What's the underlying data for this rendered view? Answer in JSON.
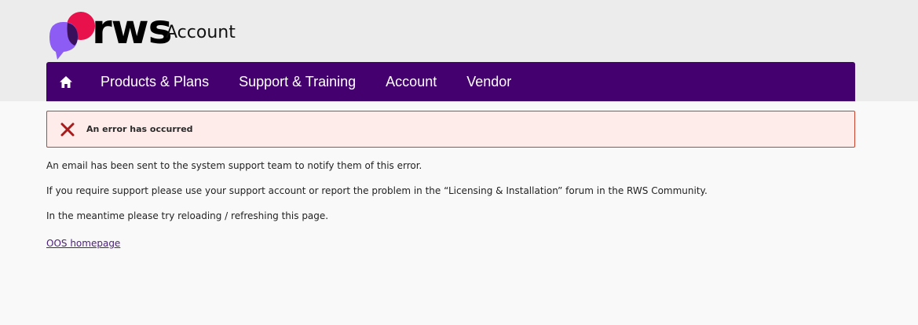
{
  "brand": {
    "wordmark": "rws",
    "suffix": "Account",
    "colors": {
      "logo_pink": "#e8114c",
      "logo_purple": "#8c5cf5",
      "logo_dark": "#3a0f5c",
      "nav_bg": "#44006e"
    }
  },
  "nav": {
    "home_icon": "home-icon",
    "items": [
      {
        "label": "Products & Plans"
      },
      {
        "label": "Support & Training"
      },
      {
        "label": "Account"
      },
      {
        "label": "Vendor"
      }
    ]
  },
  "alert": {
    "icon": "close-x-icon",
    "message": "An error has occurred",
    "colors": {
      "bg": "#fdecea",
      "border": "#c9412b",
      "icon": "#a61b1b"
    }
  },
  "content": {
    "paragraphs": [
      "An email has been sent to the system support team to notify them of this error.",
      "If you require support please use your support account or report the problem in the “Licensing & Installation” forum in the RWS Community.",
      "In the meantime please try reloading / refreshing this page."
    ],
    "link_text": "OOS homepage"
  }
}
